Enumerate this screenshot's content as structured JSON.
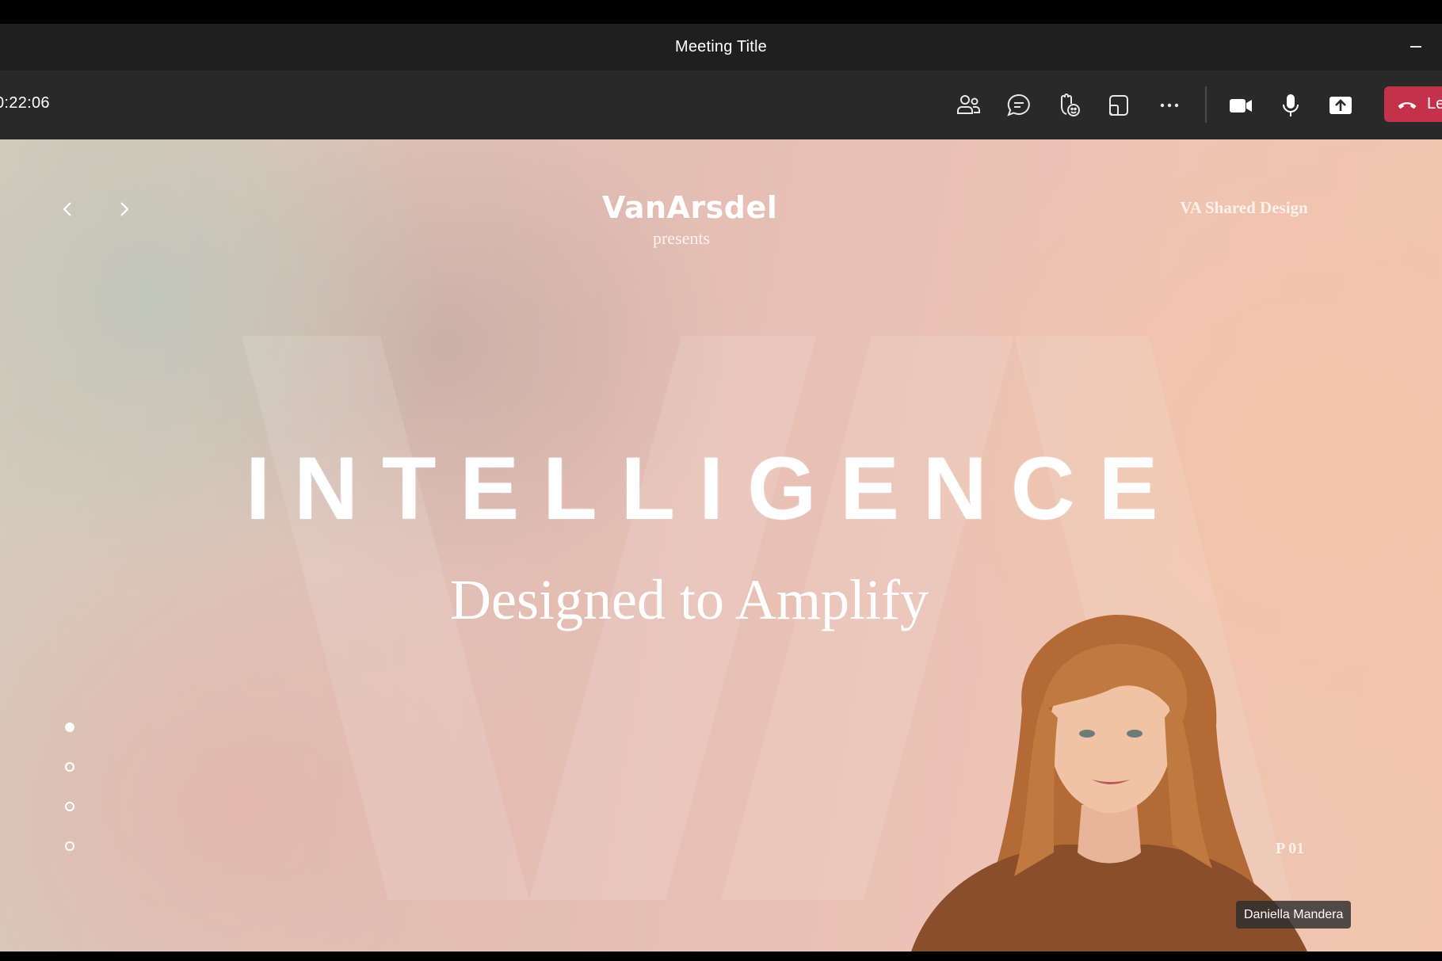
{
  "window": {
    "title": "Meeting Title"
  },
  "toolbar": {
    "timer": "0:22:06",
    "buttons": [
      "people-icon",
      "chat-icon",
      "react-icon",
      "view-icon",
      "more-icon",
      "camera-icon",
      "mic-icon",
      "share-icon"
    ],
    "leave_label": "Le",
    "leave_color": "#c4314b"
  },
  "slide": {
    "brand": "VanArsdel",
    "presents": "presents",
    "corner_label": "VA Shared Design",
    "headline": "INTELLIGENCE",
    "subheadline": "Designed to Amplify",
    "page_number": "P 01",
    "pagination": {
      "total": 4,
      "active": 1
    }
  },
  "presenter": {
    "name": "Daniella Mandera"
  },
  "colors": {
    "title_bar": "#1f1f1f",
    "toolbar": "#292929",
    "slide_text": "#ffffff"
  }
}
